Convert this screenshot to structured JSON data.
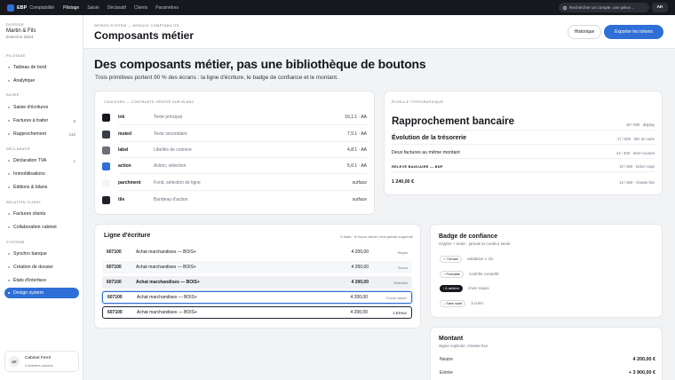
{
  "topbar": {
    "brand": "EBP",
    "brand_sub": "Comptabilité",
    "nav": [
      "Pilotage",
      "Saisie",
      "Déclaratif",
      "Clients",
      "Paramètres"
    ],
    "search_placeholder": "Rechercher un compte, une pièce…",
    "user_initials": "AK"
  },
  "sidebar": {
    "dossier_label": "DOSSIER",
    "client": "Martin & Fils",
    "exercise": "Exercice 2024",
    "sections": [
      {
        "title": "PILOTAGE",
        "items": [
          {
            "label": "Tableau de bord",
            "count": ""
          },
          {
            "label": "Analytique",
            "count": ""
          }
        ]
      },
      {
        "title": "SAISIE",
        "items": [
          {
            "label": "Saisie d'écritures",
            "count": ""
          },
          {
            "label": "Factures à traiter",
            "count": "8"
          },
          {
            "label": "Rapprochement",
            "count": "142"
          }
        ]
      },
      {
        "title": "DÉCLARATIF",
        "items": [
          {
            "label": "Déclaration TVA",
            "count": "1"
          },
          {
            "label": "Immobilisations",
            "count": ""
          },
          {
            "label": "Éditions & bilans",
            "count": ""
          }
        ]
      },
      {
        "title": "RELATION CLIENT",
        "items": [
          {
            "label": "Factures clients",
            "count": ""
          },
          {
            "label": "Collaboration cabinet",
            "count": ""
          }
        ]
      },
      {
        "title": "SYSTÈME",
        "items": [
          {
            "label": "Synchro banque",
            "count": ""
          },
          {
            "label": "Création de dossier",
            "count": ""
          },
          {
            "label": "États d'interface",
            "count": ""
          },
          {
            "label": "Design system",
            "count": ""
          }
        ]
      }
    ],
    "footer": {
      "initials": "CF",
      "name": "Cabinet Ferré",
      "sub": "3 dossiers ouverts"
    }
  },
  "header": {
    "breadcrumb": "DESIGN SYSTEM — MODULE COMPTABILITÉ",
    "title": "Composants métier",
    "history_label": "Historique",
    "export_label": "Exporter les tokens"
  },
  "hero": {
    "title": "Des composants métier, pas une bibliothèque de boutons",
    "subtitle": "Trois primitives portent 90 % des écrans : la ligne d'écriture, le badge de confiance et le montant."
  },
  "colors_card": {
    "label": "COULEURS — CONTRASTE VÉRIFIÉ SUR BLANC",
    "rows": [
      {
        "name": "ink",
        "desc": "Texte principal",
        "ratio": "16,1:1 · AA",
        "color": "#16181d",
        "border": false
      },
      {
        "name": "muted",
        "desc": "Texte secondaire",
        "ratio": "7,5:1 · AA",
        "color": "#3a3e46",
        "border": false
      },
      {
        "name": "label",
        "desc": "Libellés de colonne",
        "ratio": "4,8:1 · AA",
        "color": "#6b6f77",
        "border": false
      },
      {
        "name": "action",
        "desc": "Action, sélection",
        "ratio": "5,6:1 · AA",
        "color": "#2f6fd6",
        "border": false
      },
      {
        "name": "parchment",
        "desc": "Fond, sélection de ligne",
        "ratio": "surface",
        "color": "#f4f5f7",
        "border": false
      },
      {
        "name": "tile",
        "desc": "Bandeau d'action",
        "ratio": "surface",
        "color": "#1f2228",
        "border": false
      }
    ]
  },
  "typo_card": {
    "label": "ÉCHELLE TYPOGRAPHIQUE",
    "rows": [
      {
        "text": "Rapprochement bancaire",
        "meta": "28 / 600 · display"
      },
      {
        "text": "Évolution de la trésorerie",
        "meta": "17 / 600 · titre de carte"
      },
      {
        "text": "Deux factures au même montant",
        "meta": "14 / 400 · texte courant"
      },
      {
        "text": "RELEVÉ BANCAIRE — BNP",
        "meta": "10 / 600 · kicker caps"
      },
      {
        "text": "1 240,00 €",
        "meta": "14 / 600 · chasse fixe"
      }
    ]
  },
  "ledger_card": {
    "title": "Ligne d'écriture",
    "note": "5 états · le focus clavier n'est jamais supprimé",
    "rows": [
      {
        "code": "607100",
        "label": "Achat marchandises — BOIS+",
        "amount": "4 200,00",
        "state": "Repos"
      },
      {
        "code": "607100",
        "label": "Achat marchandises — BOIS+",
        "amount": "4 200,00",
        "state": "Survol"
      },
      {
        "code": "607100",
        "label": "Achat marchandises — BOIS+",
        "amount": "4 200,00",
        "state": "Sélection"
      },
      {
        "code": "607100",
        "label": "Achat marchandises — BOIS+",
        "amount": "4 200,00",
        "state": "Focus clavier"
      },
      {
        "code": "607100",
        "label": "Achat marchandises — BOIS+",
        "amount": "4 200,00",
        "state": "1 Erreur"
      }
    ]
  },
  "badge_card": {
    "title": "Badge de confiance",
    "subtitle": "Glyphe + texte · jamais la couleur seule",
    "rows": [
      {
        "badge": "✓ Certain",
        "desc": "validation 1 clic",
        "dark": false
      },
      {
        "badge": "~ Probable",
        "desc": "contrôle conseillé",
        "dark": false
      },
      {
        "badge": "! À arbitrer",
        "desc": "choix requis",
        "dark": true
      },
      {
        "badge": "– Sans suite",
        "desc": "à créer",
        "dark": false
      }
    ]
  },
  "amount_card": {
    "title": "Montant",
    "subtitle": "Signe explicite, chasse fixe",
    "rows": [
      {
        "label": "Neutre",
        "value": "4 200,00 €"
      },
      {
        "label": "Entrée",
        "value": "+ 3 900,00 €"
      }
    ]
  }
}
